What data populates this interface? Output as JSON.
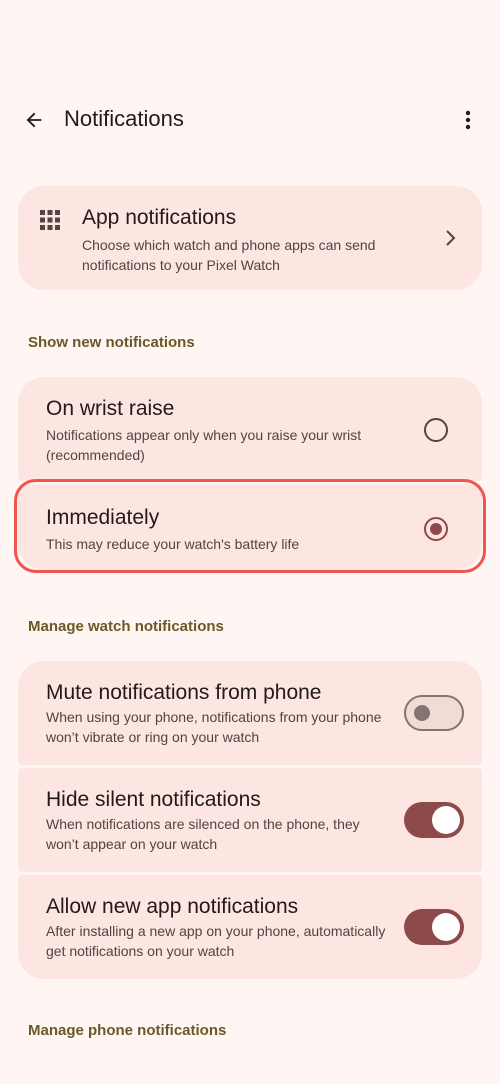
{
  "header": {
    "title": "Notifications",
    "back_icon": "arrow-back-icon",
    "more_icon": "more-vert-icon"
  },
  "app_notifications": {
    "title": "App notifications",
    "subtitle": "Choose which watch and phone apps can send notifications to your Pixel Watch",
    "icon": "apps-grid-icon"
  },
  "show_new": {
    "header": "Show new notifications",
    "options": [
      {
        "title": "On wrist raise",
        "subtitle": "Notifications appear only when you raise your wrist (recommended)",
        "selected": false
      },
      {
        "title": "Immediately",
        "subtitle": "This may reduce your watch's battery life",
        "selected": true
      }
    ]
  },
  "manage_watch": {
    "header": "Manage watch notifications",
    "items": [
      {
        "title": "Mute notifications from phone",
        "subtitle": "When using your phone, notifications from your phone won’t vibrate or ring on your watch",
        "enabled": false
      },
      {
        "title": "Hide silent notifications",
        "subtitle": "When notifications are silenced on the phone, they won’t appear on your watch",
        "enabled": true
      },
      {
        "title": "Allow new app notifications",
        "subtitle": "After installing a new app on your phone, automatically get notifications on your watch",
        "enabled": true
      }
    ]
  },
  "manage_phone": {
    "header": "Manage phone notifications"
  },
  "colors": {
    "background": "#fff6f4",
    "card": "#fde5e1",
    "accent": "#8c4a4a",
    "section_header": "#6b5827",
    "highlight": "#f0544e"
  }
}
